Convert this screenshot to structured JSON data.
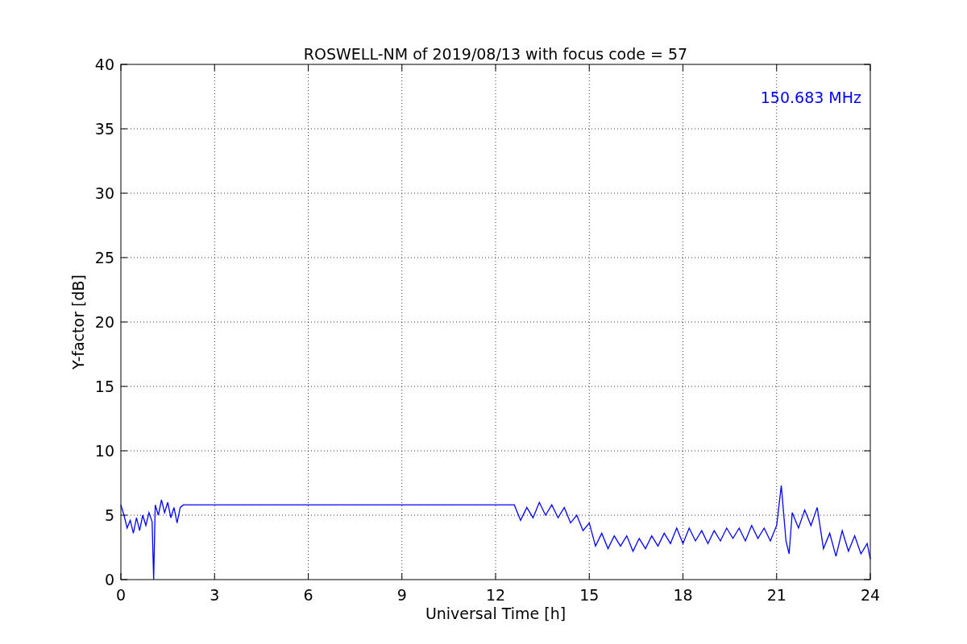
{
  "chart_data": {
    "type": "line",
    "title": "ROSWELL-NM of 2019/08/13 with focus code = 57",
    "xlabel": "Universal Time [h]",
    "ylabel": "Y-factor [dB]",
    "xlim": [
      0,
      24
    ],
    "ylim": [
      0,
      40
    ],
    "xticks": [
      0,
      3,
      6,
      9,
      12,
      15,
      18,
      21,
      24
    ],
    "yticks": [
      0,
      5,
      10,
      15,
      20,
      25,
      30,
      35,
      40
    ],
    "x": [
      0,
      0.1,
      0.2,
      0.3,
      0.4,
      0.5,
      0.6,
      0.7,
      0.8,
      0.9,
      1.0,
      1.05,
      1.1,
      1.2,
      1.3,
      1.4,
      1.5,
      1.6,
      1.7,
      1.8,
      1.9,
      2.0,
      12.6,
      12.8,
      13.0,
      13.2,
      13.4,
      13.6,
      13.8,
      14.0,
      14.2,
      14.4,
      14.6,
      14.8,
      15.0,
      15.2,
      15.4,
      15.6,
      15.8,
      16.0,
      16.2,
      16.4,
      16.6,
      16.8,
      17.0,
      17.2,
      17.4,
      17.6,
      17.8,
      18.0,
      18.2,
      18.4,
      18.6,
      18.8,
      19.0,
      19.2,
      19.4,
      19.6,
      19.8,
      20.0,
      20.2,
      20.4,
      20.6,
      20.8,
      21.0,
      21.15,
      21.3,
      21.4,
      21.5,
      21.7,
      21.9,
      22.1,
      22.3,
      22.5,
      22.7,
      22.9,
      23.1,
      23.3,
      23.5,
      23.7,
      23.9,
      24.0
    ],
    "series": [
      {
        "name": "150.683 MHz",
        "color": "#0000ff",
        "values": [
          5.8,
          5.0,
          4.0,
          4.6,
          3.6,
          4.8,
          3.8,
          5.0,
          4.2,
          5.2,
          4.5,
          0,
          5.8,
          5.0,
          6.2,
          5.2,
          6.0,
          4.8,
          5.6,
          4.4,
          5.6,
          5.8,
          5.8,
          4.6,
          5.6,
          4.8,
          6.0,
          5.0,
          5.8,
          4.8,
          5.6,
          4.4,
          5.0,
          3.8,
          4.4,
          2.6,
          3.6,
          2.4,
          3.4,
          2.6,
          3.4,
          2.2,
          3.2,
          2.4,
          3.4,
          2.6,
          3.6,
          2.8,
          4.0,
          2.8,
          4.0,
          3.0,
          3.8,
          2.8,
          3.8,
          3.0,
          4.0,
          3.2,
          4.0,
          3.0,
          4.2,
          3.2,
          4.0,
          3.0,
          4.2,
          7.3,
          3.0,
          2.0,
          5.2,
          4.0,
          5.4,
          4.2,
          5.6,
          2.4,
          3.6,
          1.8,
          3.8,
          2.2,
          3.4,
          2.0,
          2.8,
          1.6
        ]
      }
    ],
    "grid": true
  }
}
